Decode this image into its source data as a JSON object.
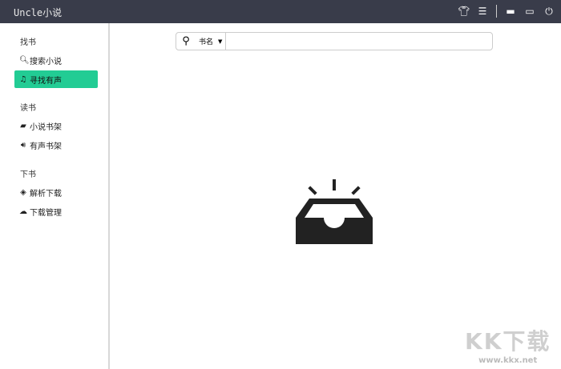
{
  "app": {
    "title": "Uncle小说"
  },
  "titlebar": {
    "icons": [
      "shirt-icon",
      "menu-icon",
      "minimize-icon",
      "maximize-icon",
      "power-icon"
    ]
  },
  "sidebar": {
    "groups": [
      {
        "label": "找书",
        "items": [
          {
            "label": "搜索小说",
            "icon": "search-icon"
          },
          {
            "label": "寻找有声",
            "icon": "music-icon",
            "active": true
          }
        ]
      },
      {
        "label": "读书",
        "items": [
          {
            "label": "小说书架",
            "icon": "book-icon"
          },
          {
            "label": "有声书架",
            "icon": "volume-icon"
          }
        ]
      },
      {
        "label": "下书",
        "items": [
          {
            "label": "解析下载",
            "icon": "parse-icon"
          },
          {
            "label": "下载管理",
            "icon": "cloud-download-icon"
          }
        ]
      }
    ]
  },
  "search": {
    "type_selected": "书名",
    "value": "",
    "placeholder": ""
  },
  "watermark": {
    "big": "KK下载",
    "small": "www.kkx.net"
  },
  "colors": {
    "titlebar": "#393c4a",
    "accent": "#22cc94"
  }
}
